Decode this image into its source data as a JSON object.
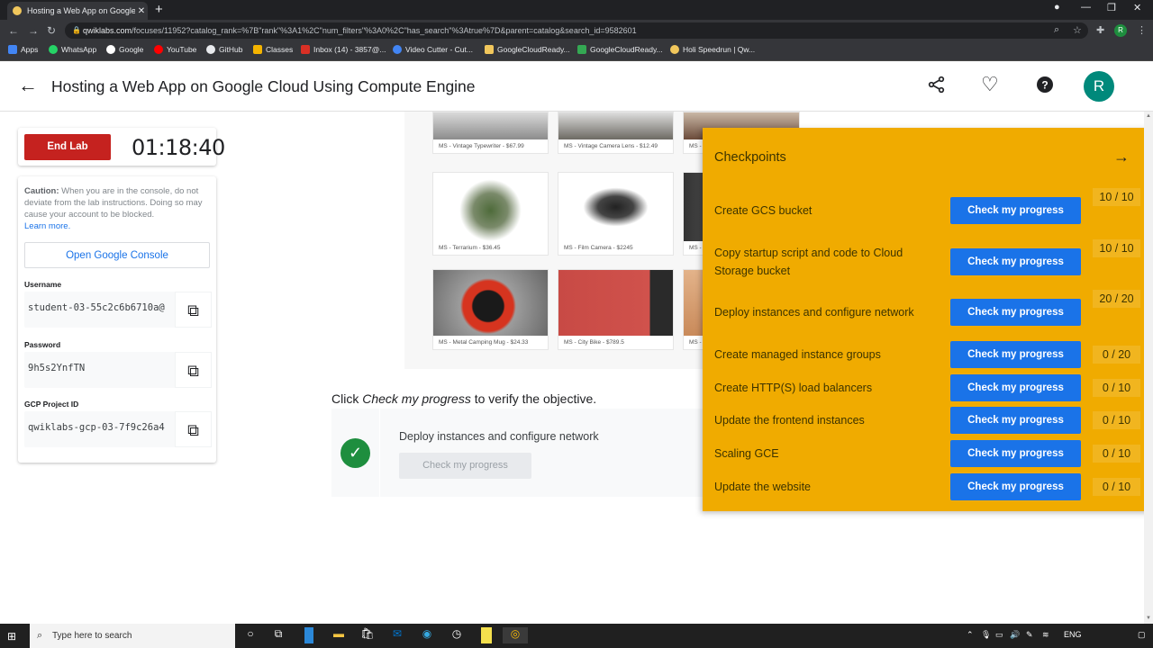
{
  "browser": {
    "tab_title": "Hosting a Web App on Google C",
    "url_host": "qwiklabs.com",
    "url_path": "/focuses/11952?catalog_rank=%7B\"rank\"%3A1%2C\"num_filters\"%3A0%2C\"has_search\"%3Atrue%7D&parent=catalog&search_id=9582601",
    "bookmarks": [
      "Apps",
      "WhatsApp",
      "Google",
      "YouTube",
      "GitHub",
      "Classes",
      "Inbox (14) - 3857@...",
      "Video Cutter - Cut...",
      "GoogleCloudReady...",
      "GoogleCloudReady...",
      "Holi Speedrun | Qw..."
    ],
    "profile_initial": "R"
  },
  "header": {
    "title": "Hosting a Web App on Google Cloud Using Compute Engine",
    "avatar_initial": "R"
  },
  "lab": {
    "end_lab_label": "End Lab",
    "timer": "01:18:40",
    "caution_bold": "Caution:",
    "caution_text": " When you are in the console, do not deviate from the lab instructions. Doing so may cause your account to be blocked.",
    "learn_more": "Learn more.",
    "open_console_label": "Open Google Console",
    "username_label": "Username",
    "username_value": "student-03-55c2c6b6710a@",
    "password_label": "Password",
    "password_value": "9h5s2YnfTN",
    "project_label": "GCP Project ID",
    "project_value": "qwiklabs-gcp-03-7f9c26a4"
  },
  "gallery": {
    "products": [
      {
        "caption": "MS - Vintage Typewriter - $67.99"
      },
      {
        "caption": "MS - Vintage Camera Lens - $12.49"
      },
      {
        "caption": "MS -"
      },
      {
        "caption": "MS - Terrarium - $36.45"
      },
      {
        "caption": "MS - Film Camera - $2245"
      },
      {
        "caption": "MS -"
      },
      {
        "caption": "MS - Metal Camping Mug - $24.33"
      },
      {
        "caption": "MS - City Bike - $789.5"
      },
      {
        "caption": "MS -"
      }
    ]
  },
  "main": {
    "instruction_prefix": "Click ",
    "instruction_em": "Check my progress",
    "instruction_suffix": " to verify the objective.",
    "objective_text": "Deploy instances and configure network",
    "objective_button": "Check my progress"
  },
  "checkpoints": {
    "title": "Checkpoints",
    "button_label": "Check my progress",
    "items": [
      {
        "label": "Create GCS bucket",
        "score": "10 / 10"
      },
      {
        "label": "Copy startup script and code to Cloud Storage bucket",
        "score": "10 / 10"
      },
      {
        "label": "Deploy instances and configure network",
        "score": "20 / 20"
      },
      {
        "label": "Create managed instance groups",
        "score": "0 / 20"
      },
      {
        "label": "Create HTTP(S) load balancers",
        "score": "0 / 10"
      },
      {
        "label": "Update the frontend instances",
        "score": "0 / 10"
      },
      {
        "label": "Scaling GCE",
        "score": "0 / 10"
      },
      {
        "label": "Update the website",
        "score": "0 / 10"
      }
    ]
  },
  "taskbar": {
    "search_placeholder": "Type here to search",
    "language": "ENG"
  },
  "colors": {
    "checkpoint_panel": "#f0ab00",
    "primary_button": "#1a73e8",
    "end_lab": "#c5221f",
    "success": "#1e8e3e"
  }
}
